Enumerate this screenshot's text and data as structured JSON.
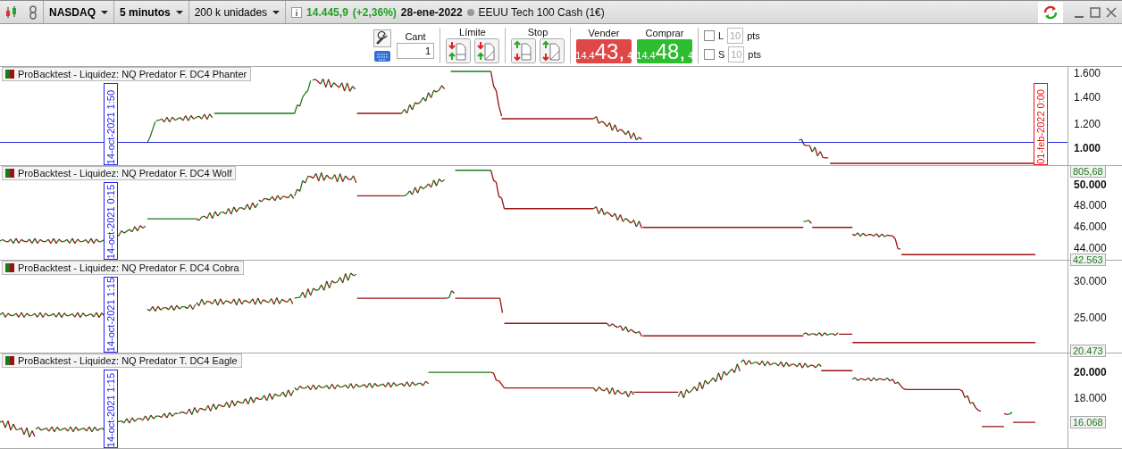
{
  "topbar": {
    "market": "NASDAQ",
    "timeframe": "5 minutos",
    "units": "200 k unidades",
    "price": "14.445,9",
    "change": "(+2,36%)",
    "date": "28-ene-2022",
    "instrument": "EEUU Tech 100 Cash (1€)"
  },
  "order_bar": {
    "quantity_label": "Cant",
    "quantity": "1",
    "limit_label": "Límite",
    "stop_label": "Stop",
    "sell": {
      "label": "Vender",
      "prefix": "14.4",
      "big": "43,",
      "sup": "4"
    },
    "buy": {
      "label": "Comprar",
      "prefix": "14.4",
      "big": "48,",
      "sup": "4"
    },
    "options": [
      {
        "label": "L",
        "checked": false,
        "placeholder": "10",
        "unit": "pts"
      },
      {
        "label": "S",
        "checked": false,
        "placeholder": "10",
        "unit": "pts"
      }
    ]
  },
  "panels": [
    {
      "title": "ProBacktest - Liquidez: NQ Predator F. DC4 Phanter",
      "start_marker": "14-oct-2021 1:50",
      "end_marker": "01-feb-2022 0:00",
      "baseline": true,
      "ticks": [
        {
          "label": "1.600",
          "bold": false
        },
        {
          "label": "1.400",
          "bold": false
        },
        {
          "label": "1.200",
          "bold": false
        },
        {
          "label": "1.000",
          "bold": true
        }
      ],
      "last_value": "805,68"
    },
    {
      "title": "ProBacktest - Liquidez: NQ Predator F. DC4 Wolf",
      "start_marker": "14-oct-2021 0:15",
      "baseline": false,
      "ticks": [
        {
          "label": "50.000",
          "bold": true
        },
        {
          "label": "48.000",
          "bold": false
        },
        {
          "label": "46.000",
          "bold": false
        },
        {
          "label": "44.000",
          "bold": false
        }
      ],
      "last_value": "42.563"
    },
    {
      "title": "ProBacktest - Liquidez: NQ Predator F. DC4 Cobra",
      "start_marker": "14-oct-2021 1:15",
      "baseline": false,
      "ticks": [
        {
          "label": "30.000",
          "bold": false
        },
        {
          "label": "25.000",
          "bold": false
        }
      ],
      "last_value": "20.473"
    },
    {
      "title": "ProBacktest - Liquidez: NQ Predator T. DC4 Eagle",
      "start_marker": "14-oct-2021 1:15",
      "baseline": false,
      "ticks": [
        {
          "label": "20.000",
          "bold": true
        },
        {
          "label": "18.000",
          "bold": false
        }
      ],
      "last_value": "16.068"
    }
  ]
}
